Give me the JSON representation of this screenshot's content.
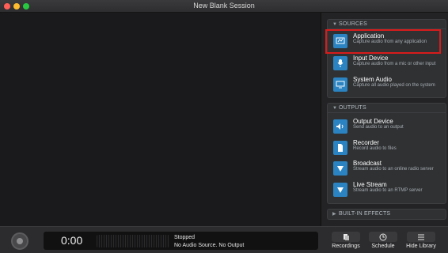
{
  "window": {
    "title": "New Blank Session"
  },
  "sources": {
    "header": "SOURCES",
    "items": [
      {
        "name": "Application",
        "desc": "Capture audio from any application",
        "icon": "application-icon"
      },
      {
        "name": "Input Device",
        "desc": "Capture audio from a mic or other input",
        "icon": "microphone-icon"
      },
      {
        "name": "System Audio",
        "desc": "Capture all audio played on the system",
        "icon": "monitor-icon"
      }
    ]
  },
  "outputs": {
    "header": "OUTPUTS",
    "items": [
      {
        "name": "Output Device",
        "desc": "Send audio to an output",
        "icon": "speaker-icon"
      },
      {
        "name": "Recorder",
        "desc": "Record audio to files",
        "icon": "file-icon"
      },
      {
        "name": "Broadcast",
        "desc": "Stream audio to an online radio server",
        "icon": "broadcast-icon"
      },
      {
        "name": "Live Stream",
        "desc": "Stream audio to an RTMP server",
        "icon": "live-stream-icon"
      }
    ]
  },
  "effects": {
    "header": "BUILT-IN EFFECTS"
  },
  "transport": {
    "timer": "0:00",
    "status": "Stopped",
    "detail": "No Audio Source. No Output"
  },
  "toolbar": {
    "recordings": "Recordings",
    "schedule": "Schedule",
    "hide_library": "Hide Library"
  },
  "colors": {
    "accent": "#2b83c1",
    "highlight": "#d81b1b"
  }
}
